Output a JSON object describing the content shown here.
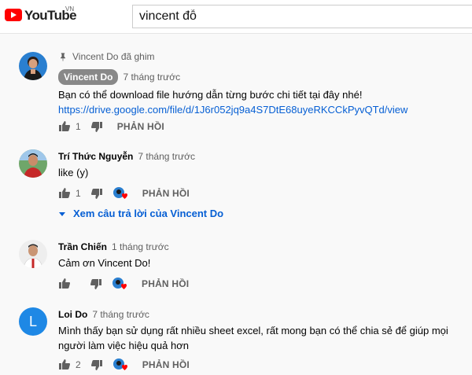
{
  "brand": {
    "name": "YouTube",
    "country": "VN"
  },
  "search": {
    "value": "vincent đỗ"
  },
  "colors": {
    "brand_red": "#ff0000",
    "link_blue": "#065fd4",
    "heart_red": "#ff0000",
    "badge_gray": "#888888",
    "avatar_blue": "#1e88e5"
  },
  "icons": [
    "youtube-logo-icon",
    "pin-icon",
    "thumbs-up-icon",
    "thumbs-down-icon",
    "creator-heart-icon",
    "caret-down-icon"
  ],
  "comments": [
    {
      "pinned_label": "Vincent Do đã ghim",
      "author": "Vincent Do",
      "time": "7 tháng trước",
      "text": "Bạn có thể download file hướng dẫn từng bước chi tiết tại đây nhé!",
      "link": "https://drive.google.com/file/d/1J6r052jq9a4S7DtE68uyeRKCCkPyvQTd/view",
      "likes": "1",
      "reply_label": "PHẢN HỒI"
    },
    {
      "author": "Trí Thức Nguyễn",
      "time": "7 tháng trước",
      "text": "like (y)",
      "likes": "1",
      "reply_label": "PHẢN HỒI",
      "view_replies": "Xem câu trả lời của Vincent Do"
    },
    {
      "author": "Trần Chiến",
      "time": "1 tháng trước",
      "text": "Cảm ơn Vincent Do!",
      "reply_label": "PHẢN HỒI"
    },
    {
      "author": "Loi Do",
      "avatar_letter": "L",
      "time": "7 tháng trước",
      "text": "Mình thấy bạn sử dụng rất nhiều sheet excel, rất mong bạn có thể chia sẻ để giúp mọi người làm việc hiệu quả hơn",
      "likes": "2",
      "reply_label": "PHẢN HỒI"
    }
  ]
}
